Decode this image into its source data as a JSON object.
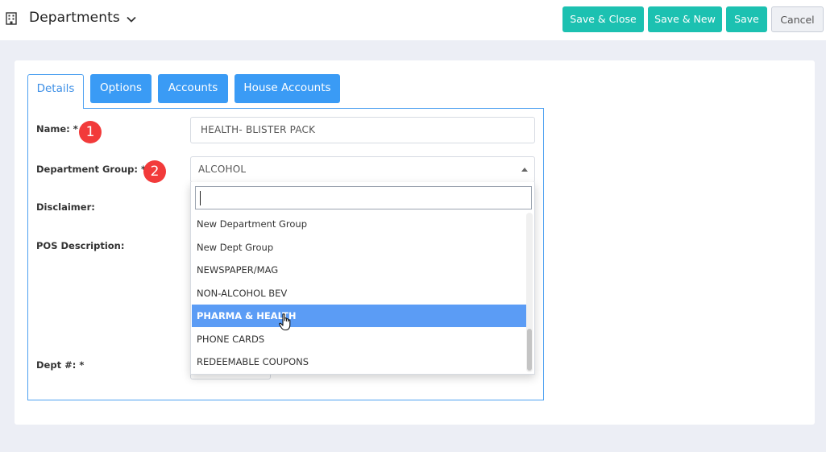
{
  "header": {
    "title": "Departments",
    "buttons": {
      "save_close": "Save & Close",
      "save_new": "Save & New",
      "save": "Save",
      "cancel": "Cancel"
    }
  },
  "tabs": [
    {
      "label": "Details",
      "active": true
    },
    {
      "label": "Options",
      "active": false
    },
    {
      "label": "Accounts",
      "active": false
    },
    {
      "label": "House Accounts",
      "active": false
    }
  ],
  "form": {
    "name_label": "Name: *",
    "name_value": "HEALTH- BLISTER PACK",
    "group_label": "Department Group: *",
    "group_value": "ALCOHOL",
    "disclaimer_label": "Disclaimer:",
    "pos_label": "POS Description:",
    "dept_label": "Dept #: *"
  },
  "markers": [
    "1",
    "2"
  ],
  "dropdown": {
    "search_value": "",
    "options": [
      "New Department Group",
      "New Dept Group",
      "NEWSPAPER/MAG",
      "NON-ALCOHOL BEV",
      "PHARMA & HEALTH",
      "PHONE CARDS",
      "REDEEMABLE COUPONS"
    ],
    "highlighted": "PHARMA & HEALTH"
  },
  "colors": {
    "teal_button": "#1cc1b1",
    "tab_blue": "#3a9bf5",
    "highlight": "#5b9cf5",
    "marker_red": "#f23a3a"
  }
}
